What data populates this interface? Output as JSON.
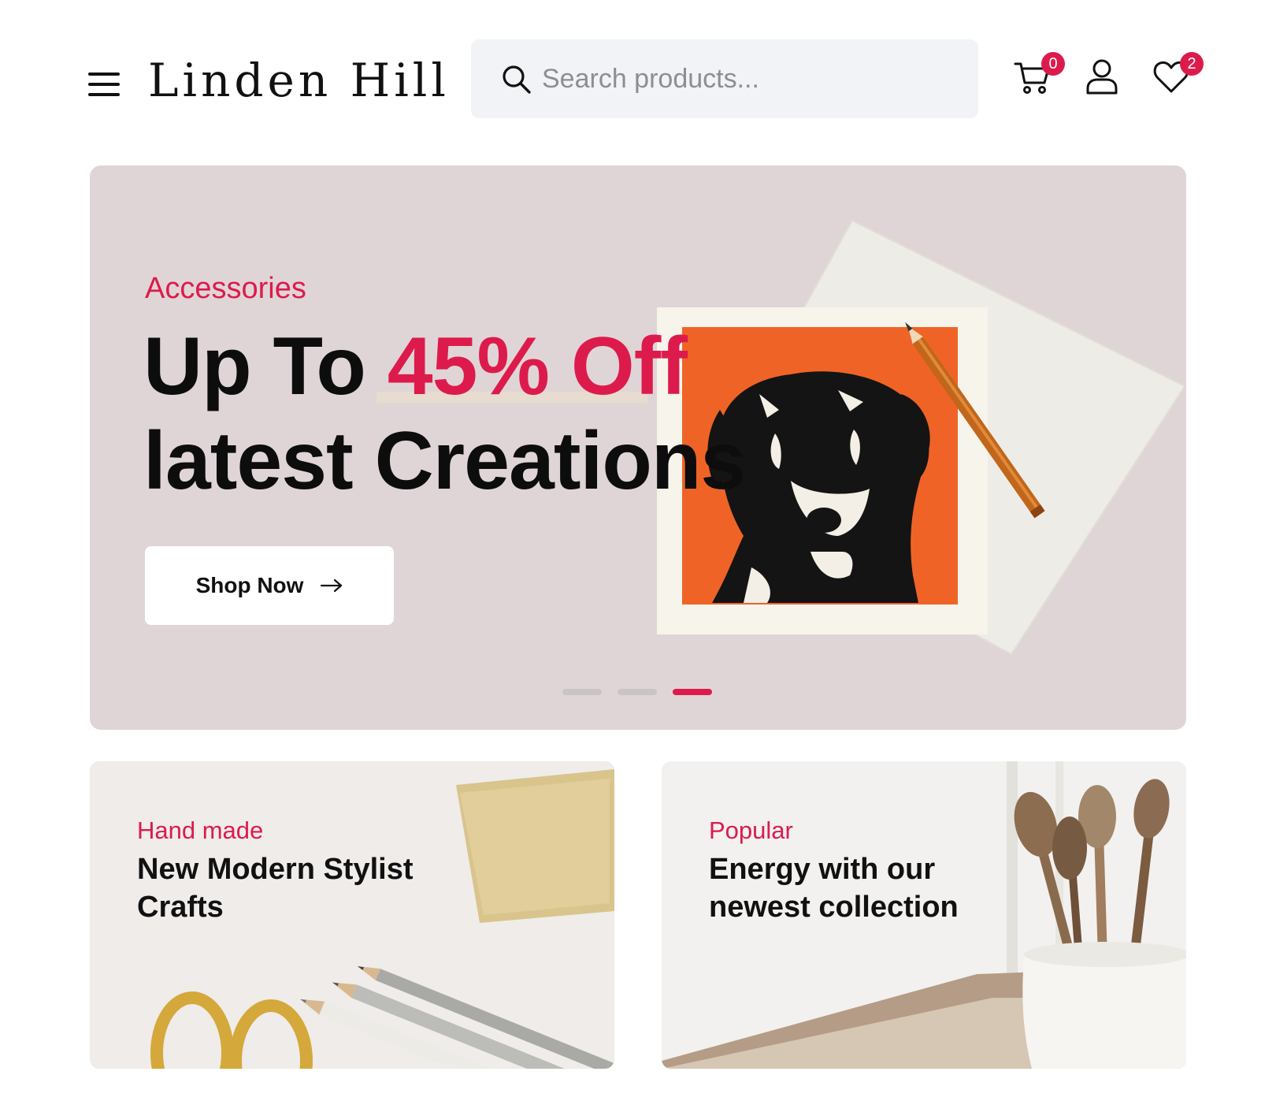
{
  "header": {
    "brand": "Linden Hill",
    "search": {
      "placeholder": "Search products..."
    },
    "cart": {
      "count": "0"
    },
    "wishlist": {
      "count": "2"
    }
  },
  "hero": {
    "tag": "Accessories",
    "title_prefix": "Up To ",
    "title_accent": "45% Off",
    "title_line2": "latest Creations",
    "button_label": "Shop Now",
    "slides": 3,
    "active_slide": 3
  },
  "cards": [
    {
      "tag": "Hand made",
      "title": "New Modern Stylist Crafts"
    },
    {
      "tag": "Popular",
      "title": "Energy with our newest collection"
    }
  ],
  "colors": {
    "accent": "#dc1b4c",
    "hero_bg": "#e0d5d6",
    "search_bg": "#f2f3f6"
  },
  "icons": [
    "menu-icon",
    "search-icon",
    "cart-icon",
    "user-icon",
    "heart-icon",
    "arrow-right-icon"
  ]
}
